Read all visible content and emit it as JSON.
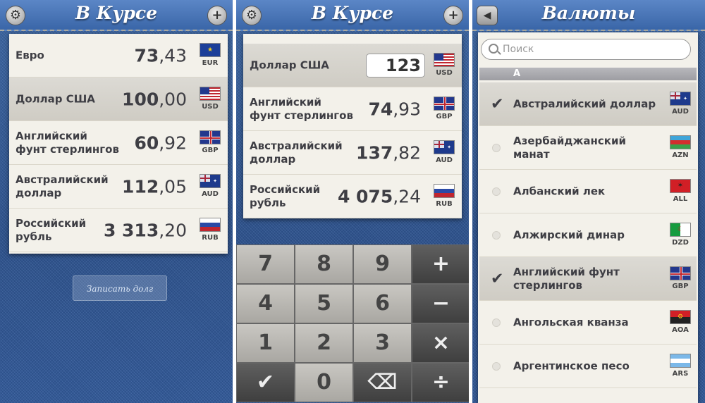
{
  "screen1": {
    "title": "В Курсе",
    "rows": [
      {
        "name": "Евро",
        "int": "73",
        "dec": ",43",
        "code": "EUR",
        "flag": "eu"
      },
      {
        "name": "Доллар США",
        "int": "100",
        "dec": ",00",
        "code": "USD",
        "flag": "us"
      },
      {
        "name": "Английский фунт стерлингов",
        "int": "60",
        "dec": ",92",
        "code": "GBP",
        "flag": "gb"
      },
      {
        "name": "Австралийский доллар",
        "int": "112",
        "dec": ",05",
        "code": "AUD",
        "flag": "au"
      },
      {
        "name": "Российский рубль",
        "int": "3 313",
        "dec": ",20",
        "code": "RUB",
        "flag": "ru"
      }
    ],
    "selected_index": 1,
    "debt_button": "Записать долг"
  },
  "screen2": {
    "title": "В Курсе",
    "input_row": {
      "name": "Доллар США",
      "amount": "123",
      "code": "USD",
      "flag": "us"
    },
    "rows": [
      {
        "name": "Английский фунт стерлингов",
        "int": "74",
        "dec": ",93",
        "code": "GBP",
        "flag": "gb"
      },
      {
        "name": "Австралийский доллар",
        "int": "137",
        "dec": ",82",
        "code": "AUD",
        "flag": "au"
      },
      {
        "name": "Российский рубль",
        "int": "4 075",
        "dec": ",24",
        "code": "RUB",
        "flag": "ru"
      }
    ],
    "keys": [
      "7",
      "8",
      "9",
      "+",
      "4",
      "5",
      "6",
      "−",
      "1",
      "2",
      "3",
      "×",
      "✔",
      "0",
      "⌫",
      "÷"
    ]
  },
  "screen3": {
    "title": "Валюты",
    "search_placeholder": "Поиск",
    "section": "А",
    "rows": [
      {
        "name": "Австралийский доллар",
        "code": "AUD",
        "checked": true,
        "flag": "au"
      },
      {
        "name": "Азербайджанский манат",
        "code": "AZN",
        "checked": false,
        "flag": "az"
      },
      {
        "name": "Албанский лек",
        "code": "ALL",
        "checked": false,
        "flag": "al"
      },
      {
        "name": "Алжирский динар",
        "code": "DZD",
        "checked": false,
        "flag": "dz"
      },
      {
        "name": "Английский фунт стерлингов",
        "code": "GBP",
        "checked": true,
        "flag": "gb"
      },
      {
        "name": "Ангольская кванза",
        "code": "AOA",
        "checked": false,
        "flag": "ao"
      },
      {
        "name": "Аргентинское песо",
        "code": "ARS",
        "checked": false,
        "flag": "ar"
      }
    ]
  },
  "icons": {
    "settings": "gear-icon",
    "add": "plus-icon",
    "back": "back-arrow-icon",
    "search": "search-icon",
    "check": "checkmark-icon"
  }
}
